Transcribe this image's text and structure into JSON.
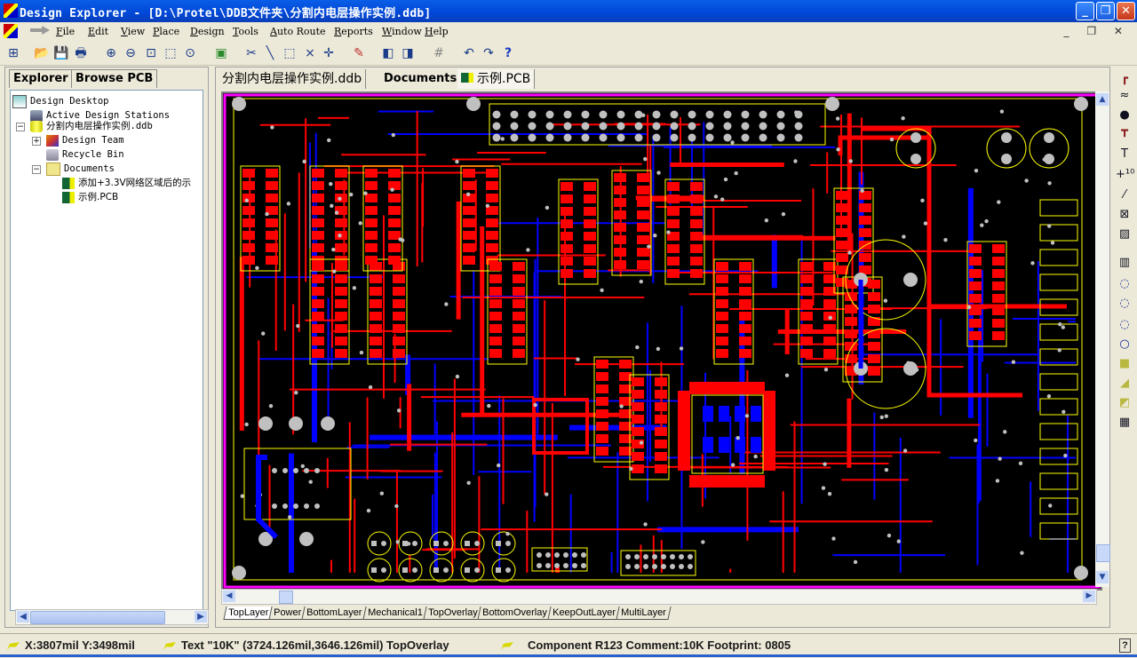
{
  "window": {
    "title": "Design Explorer - [D:\\Protel\\DDB文件夹\\分割内电层操作实例.ddb]",
    "minimize_label": "_",
    "restore_label": "❐",
    "close_label": "✕"
  },
  "menubar": {
    "items": [
      "File",
      "Edit",
      "View",
      "Place",
      "Design",
      "Tools",
      "Auto Route",
      "Reports",
      "Window",
      "Help"
    ],
    "mdi_controls": "_ ❐ ✕"
  },
  "toolbar": {
    "icons": [
      "design-manager-icon",
      "open-icon",
      "save-icon",
      "print-icon",
      "zoom-in-icon",
      "zoom-out-icon",
      "zoom-fit-icon",
      "zoom-area-icon",
      "zoom-selection-icon",
      "browse-component-icon",
      "cut-icon",
      "line-icon",
      "select-area-icon",
      "deselect-icon",
      "move-icon",
      "magic-wand-icon",
      "3d-view-icon",
      "report-icon",
      "grid-icon",
      "undo-icon",
      "redo-icon",
      "help-icon"
    ],
    "glyphs": [
      "⊞",
      "📂",
      "💾",
      "🖶",
      "⊕",
      "⊖",
      "⊡",
      "⬚",
      "⊙",
      "▣",
      "✂",
      "╲",
      "⬚",
      "⨯",
      "✛",
      "✎",
      "◧",
      "◨",
      "#",
      "↶",
      "↷",
      "?"
    ]
  },
  "explorer": {
    "tabs": [
      "Explorer",
      "Browse PCB"
    ],
    "tree": [
      {
        "label": "Design Desktop",
        "level": 0
      },
      {
        "label": "Active Design Stations",
        "level": 1
      },
      {
        "label": "分割内电层操作实例.ddb",
        "level": 1,
        "expander": "−"
      },
      {
        "label": "Design Team",
        "level": 2,
        "expander": "+"
      },
      {
        "label": "Recycle Bin",
        "level": 2
      },
      {
        "label": "Documents",
        "level": 2,
        "expander": "−"
      },
      {
        "label": "添加+3.3V网络区域后的示",
        "level": 3
      },
      {
        "label": "示例.PCB",
        "level": 3
      }
    ]
  },
  "documents": {
    "tabs": [
      "分割内电层操作实例.ddb",
      "Documents",
      "示例.PCB"
    ],
    "active_tab": "示例.PCB"
  },
  "layers": {
    "tabs": [
      "TopLayer",
      "Power",
      "BottomLayer",
      "Mechanical1",
      "TopOverlay",
      "BottomOverlay",
      "KeepOutLayer",
      "MultiLayer"
    ],
    "active": "TopLayer"
  },
  "colors": {
    "top_layer": "#ff0000",
    "bottom_layer": "#0000ff",
    "top_overlay": "#ffff00",
    "multilayer_pad": "#c0c0c0",
    "board_outline": "#ff00ff",
    "background": "#000000"
  },
  "placement_tools": [
    "route-icon",
    "arc-line-icon",
    "via-icon",
    "pad-icon",
    "text-icon",
    "coordinate-icon",
    "dimension-icon",
    "origin-icon",
    "fill-area-icon",
    "component-icon",
    "arc-center-icon",
    "arc-edge-icon",
    "arc-any-icon",
    "circle-icon",
    "fill-icon",
    "polygon-icon",
    "split-plane-icon",
    "array-paste-icon"
  ],
  "placement_glyphs": [
    "┏",
    "≈",
    "●",
    "┳",
    "T",
    "+¹⁰",
    "⁄",
    "⊠",
    "▨",
    "▥",
    "◌",
    "◌",
    "◌",
    "○",
    "■",
    "◢",
    "◩",
    "▦"
  ],
  "status": {
    "cursor": "X:3807mil Y:3498mil",
    "object": "Text \"10K\" (3724.126mil,3646.126mil)  TopOverlay",
    "component": "Component R123 Comment:10K Footprint: 0805",
    "help_label": "?"
  }
}
